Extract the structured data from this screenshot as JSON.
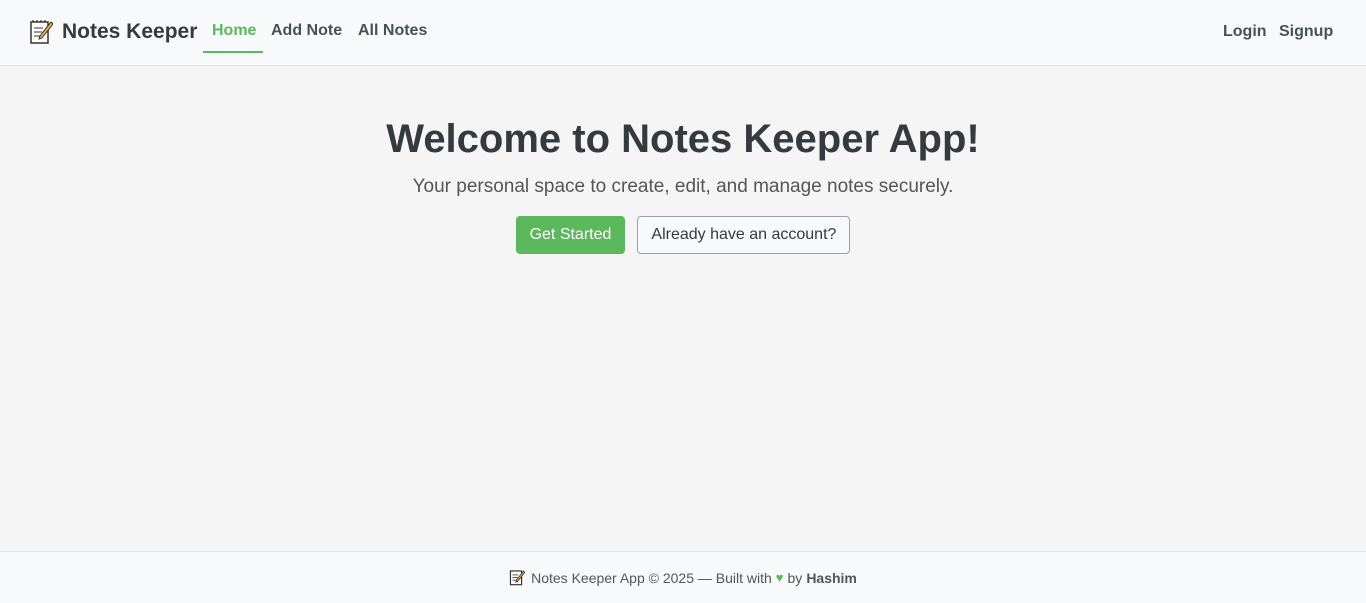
{
  "navbar": {
    "brand_icon": "memo-icon",
    "brand_name": "Notes Keeper",
    "links": {
      "home": "Home",
      "add_note": "Add Note",
      "all_notes": "All Notes"
    },
    "auth": {
      "login": "Login",
      "signup": "Signup"
    }
  },
  "hero": {
    "title": "Welcome to Notes Keeper App!",
    "subtitle": "Your personal space to create, edit, and manage notes securely.",
    "primary_button": "Get Started",
    "secondary_button": "Already have an account?"
  },
  "footer": {
    "icon": "memo-icon",
    "text": "Notes Keeper App © 2025 — Built with",
    "heart_icon": "heart-icon",
    "by": "by",
    "author": "Hashim"
  },
  "colors": {
    "accent": "#5cb85c",
    "text": "#343a40",
    "background": "#f4f5f4"
  }
}
